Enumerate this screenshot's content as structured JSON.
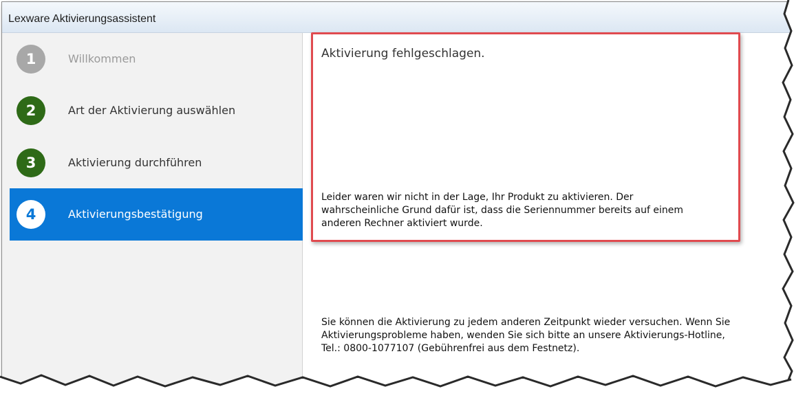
{
  "window": {
    "title": "Lexware Aktivierungsassistent"
  },
  "steps": [
    {
      "number": "1",
      "label": "Willkommen"
    },
    {
      "number": "2",
      "label": "Art der Aktivierung auswählen"
    },
    {
      "number": "3",
      "label": "Aktivierung durchführen"
    },
    {
      "number": "4",
      "label": "Aktivierungsbestätigung"
    }
  ],
  "content": {
    "error_title": "Aktivierung fehlgeschlagen.",
    "error_message": "Leider waren wir nicht in der Lage, Ihr Produkt zu aktivieren. Der wahrscheinliche Grund dafür ist, dass die Seriennummer bereits auf einem anderen Rechner aktiviert wurde.",
    "hint_message": "Sie können die Aktivierung zu jedem anderen Zeitpunkt wieder versuchen. Wenn Sie Aktivierungsprobleme haben, wenden Sie sich bitte an unsere Aktivierungs-Hotline, Tel.: 0800-1077107 (Gebührenfrei aus dem Festnetz)."
  },
  "colors": {
    "active_step": "#0a78d7",
    "completed_step": "#2e6a17",
    "inactive_step": "#a8a8a8",
    "highlight_frame": "#e04a4f"
  }
}
